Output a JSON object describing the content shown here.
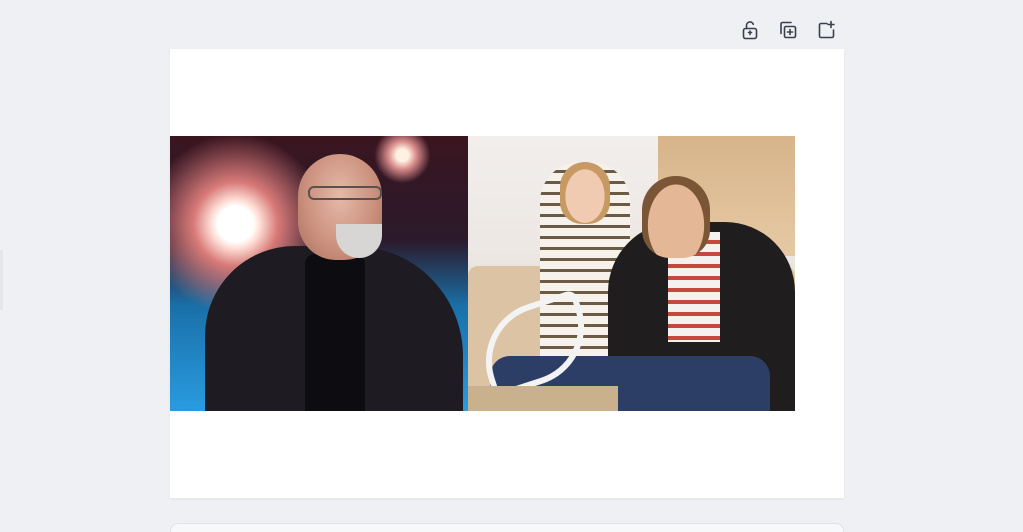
{
  "toolbar": {
    "buttons": [
      {
        "icon": "unlock-icon"
      },
      {
        "icon": "duplicate-icon"
      },
      {
        "icon": "add-page-icon"
      }
    ]
  },
  "canvas": {
    "images": [
      {
        "icon": "photo-man-speaking"
      },
      {
        "icon": "photo-couple-bills"
      }
    ]
  },
  "colors": {
    "background": "#eef0f4",
    "card": "#ffffff",
    "icon": "#3a3f4a"
  }
}
